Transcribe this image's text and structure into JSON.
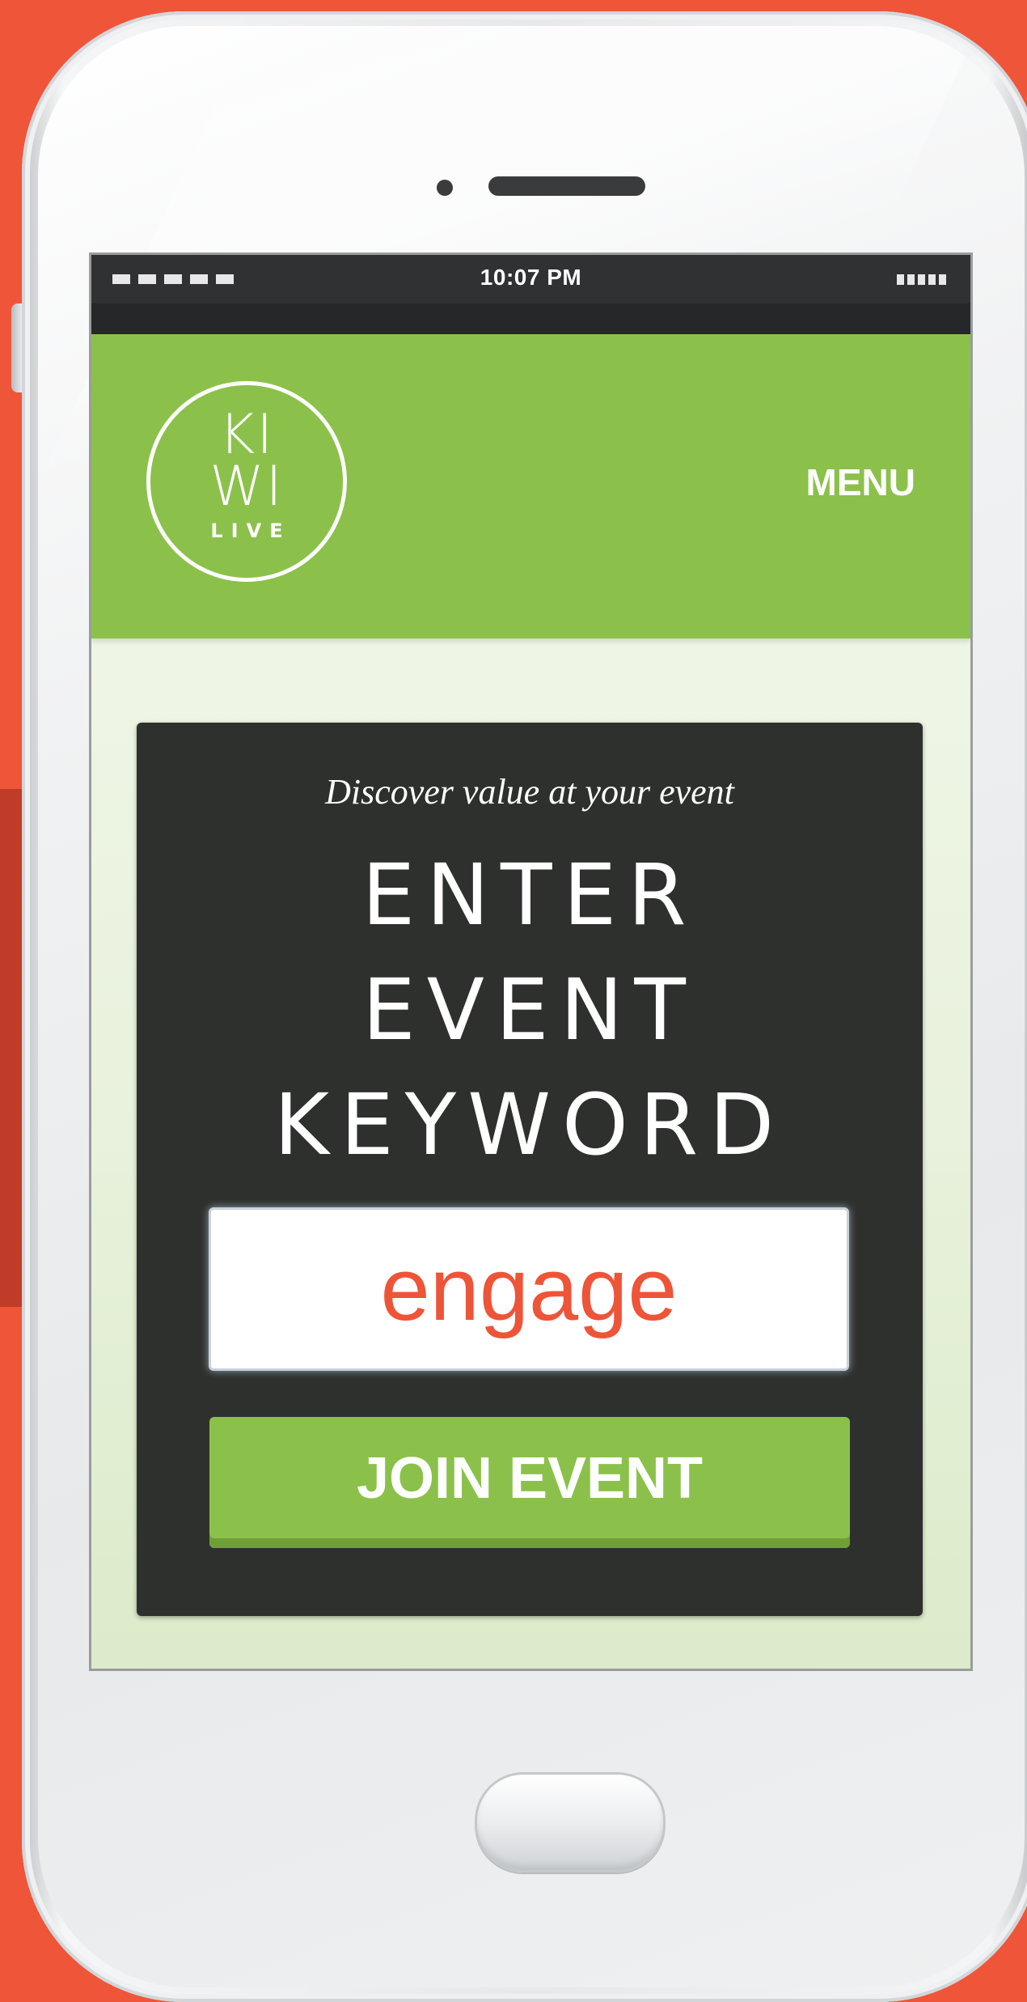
{
  "status_bar": {
    "time": "10:07 PM",
    "signal_icon": "signal-bars-icon",
    "battery_icon": "battery-icon"
  },
  "header": {
    "logo": {
      "line1": "KI",
      "line2": "WI",
      "line3": "LIVE"
    },
    "menu_label": "MENU"
  },
  "card": {
    "tagline": "Discover value at your event",
    "headline": [
      "ENTER",
      "EVENT",
      "KEYWORD"
    ],
    "keyword_input": {
      "value": "engage"
    },
    "join_button_label": "JOIN EVENT"
  },
  "colors": {
    "background": "#ef5538",
    "brand_green": "#8bc14a",
    "card_dark": "#2e302d",
    "input_text": "#ee5438"
  }
}
